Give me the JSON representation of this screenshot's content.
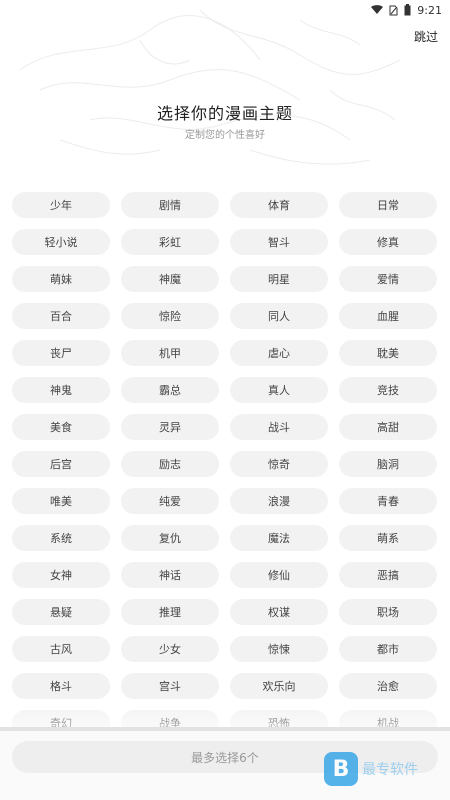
{
  "status_bar": {
    "time": "9:21"
  },
  "header": {
    "skip_label": "跳过",
    "title": "选择你的漫画主题",
    "subtitle": "定制您的个性喜好"
  },
  "themes": [
    "少年",
    "剧情",
    "体育",
    "日常",
    "轻小说",
    "彩虹",
    "智斗",
    "修真",
    "萌妹",
    "神魔",
    "明星",
    "爱情",
    "百合",
    "惊险",
    "同人",
    "血腥",
    "丧尸",
    "机甲",
    "虐心",
    "耽美",
    "神鬼",
    "霸总",
    "真人",
    "竞技",
    "美食",
    "灵异",
    "战斗",
    "高甜",
    "后宫",
    "励志",
    "惊奇",
    "脑洞",
    "唯美",
    "纯爱",
    "浪漫",
    "青春",
    "系统",
    "复仇",
    "魔法",
    "萌系",
    "女神",
    "神话",
    "修仙",
    "恶搞",
    "悬疑",
    "推理",
    "权谋",
    "职场",
    "古风",
    "少女",
    "惊悚",
    "都市",
    "格斗",
    "宫斗",
    "欢乐向",
    "治愈",
    "奇幻",
    "战争",
    "恐怖",
    "机战"
  ],
  "footer": {
    "button_label": "最多选择6个",
    "watermark_text": "最专软件"
  }
}
